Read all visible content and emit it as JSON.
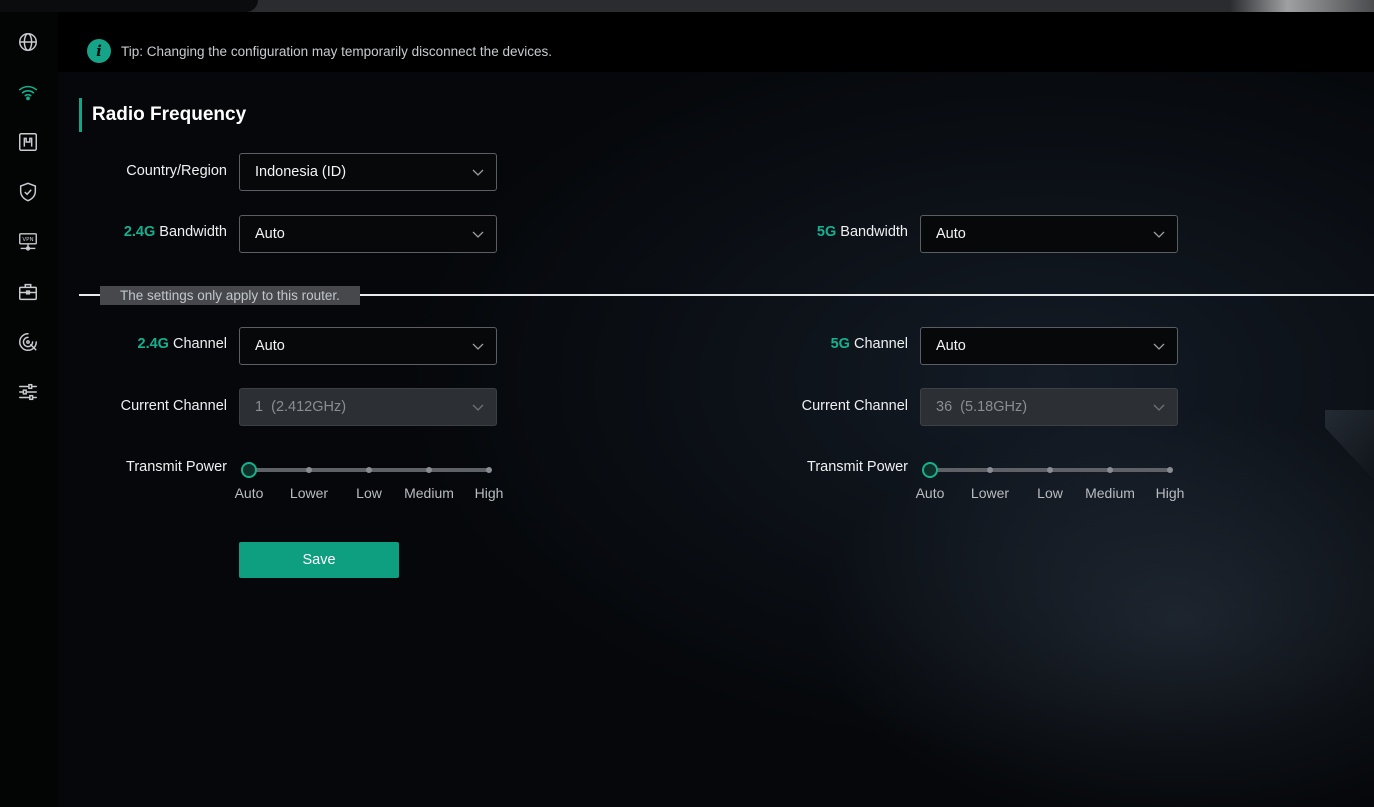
{
  "tip": {
    "text": "Tip: Changing the configuration may temporarily disconnect the devices."
  },
  "section": {
    "title": "Radio Frequency"
  },
  "country_region": {
    "label": "Country/Region",
    "value": "Indonesia (ID)"
  },
  "band_24": {
    "prefix": "2.4G",
    "bandwidth_label": "Bandwidth",
    "bandwidth_value": "Auto",
    "channel_label": "Channel",
    "channel_value": "Auto",
    "current_channel_label": "Current Channel",
    "current_channel_value": "1  (2.412GHz)",
    "transmit_power_label": "Transmit Power",
    "transmit_power_selected": "Auto",
    "transmit_power_levels": [
      "Auto",
      "Lower",
      "Low",
      "Medium",
      "High"
    ]
  },
  "band_5": {
    "prefix": "5G",
    "bandwidth_label": "Bandwidth",
    "bandwidth_value": "Auto",
    "channel_label": "Channel",
    "channel_value": "Auto",
    "current_channel_label": "Current Channel",
    "current_channel_value": "36  (5.18GHz)",
    "transmit_power_label": "Transmit Power",
    "transmit_power_selected": "Auto",
    "transmit_power_levels": [
      "Auto",
      "Lower",
      "Low",
      "Medium",
      "High"
    ]
  },
  "divider": {
    "note": "The settings only apply to this router."
  },
  "actions": {
    "save_label": "Save"
  },
  "sidebar": {
    "items": [
      {
        "icon": "globe-icon",
        "active": false
      },
      {
        "icon": "wifi-icon",
        "active": true
      },
      {
        "icon": "network-port-icon",
        "active": false
      },
      {
        "icon": "shield-check-icon",
        "active": false
      },
      {
        "icon": "vpn-icon",
        "active": false
      },
      {
        "icon": "toolbox-icon",
        "active": false
      },
      {
        "icon": "diagnostics-icon",
        "active": false
      },
      {
        "icon": "settings-sliders-icon",
        "active": false
      }
    ]
  },
  "colors": {
    "accent": "#17b08f",
    "background": "#050607",
    "button": "#0e9e80"
  }
}
